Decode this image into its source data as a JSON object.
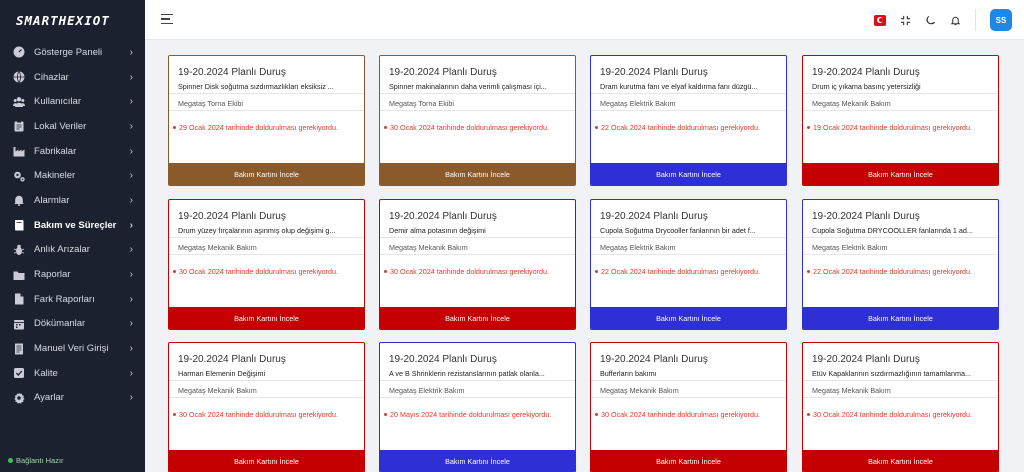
{
  "app": {
    "logo_text": "SMARTHEXIOT",
    "status_text": "Bağlantı Hazır"
  },
  "sidebar": {
    "items": [
      {
        "label": "Gösterge Paneli",
        "icon": "gauge-icon"
      },
      {
        "label": "Cihazlar",
        "icon": "globe-icon"
      },
      {
        "label": "Kullanıcılar",
        "icon": "users-icon"
      },
      {
        "label": "Lokal Veriler",
        "icon": "clipboard-icon"
      },
      {
        "label": "Fabrikalar",
        "icon": "factory-icon"
      },
      {
        "label": "Makineler",
        "icon": "gears-icon"
      },
      {
        "label": "Alarmlar",
        "icon": "bell-icon"
      },
      {
        "label": "Bakım ve Süreçler",
        "icon": "book-icon",
        "active": true
      },
      {
        "label": "Anlık Arızalar",
        "icon": "bug-icon"
      },
      {
        "label": "Raporlar",
        "icon": "folder-icon"
      },
      {
        "label": "Fark Raporları",
        "icon": "file-icon"
      },
      {
        "label": "Dökümanlar",
        "icon": "calendar-icon"
      },
      {
        "label": "Manuel Veri Girişi",
        "icon": "document-icon"
      },
      {
        "label": "Kalite",
        "icon": "check-square-icon"
      },
      {
        "label": "Ayarlar",
        "icon": "gear-icon"
      }
    ]
  },
  "topbar": {
    "menu_icon": "hamburger-icon",
    "language_flag": "turkey-flag-icon",
    "fullscreen_icon": "compress-icon",
    "theme_icon": "moon-icon",
    "notification_icon": "bell-icon",
    "avatar_initials": "SS"
  },
  "colors": {
    "brown": "#8b5a2b",
    "blue": "#2f2fd6",
    "red": "#c40000",
    "due_text": "#e03a2f",
    "avatar": "#1e88e5"
  },
  "cards": [
    {
      "title": "19-20.2024 Planlı Duruş",
      "description": "Spinner Disk soğutma sızdırmazlıkları eksiksiz ...",
      "team": "Megataş Torna Ekibi",
      "due": "29 Ocak 2024 tarihinde doldurulması gerekiyordu.",
      "button": "Bakım Kartını İncele",
      "color": "brown"
    },
    {
      "title": "19-20.2024 Planlı Duruş",
      "description": "Spinner makinalarının daha verimli çalışması içi...",
      "team": "Megataş Torna Ekibi",
      "due": "30 Ocak 2024 tarihinde doldurulması gerekiyordu.",
      "button": "Bakım Kartını İncele",
      "color": "brown"
    },
    {
      "title": "19-20.2024 Planlı Duruş",
      "description": "Dram kurutma fanı ve elyaf kaldırma fanı düzgü...",
      "team": "Megataş Elektrik Bakım",
      "due": "22 Ocak 2024 tarihinde doldurulması gerekiyordu.",
      "button": "Bakım Kartını İncele",
      "color": "blue"
    },
    {
      "title": "19-20.2024 Planlı Duruş",
      "description": "Drum iç yıkama basınç yetersizliği",
      "team": "Megataş Mekanik Bakım",
      "due": "19 Ocak 2024 tarihinde doldurulması gerekiyordu.",
      "button": "Bakım Kartını İncele",
      "color": "red"
    },
    {
      "title": "19-20.2024 Planlı Duruş",
      "description": "Drum yüzey fırçalarının aşınmış olup değişimi g...",
      "team": "Megataş Mekanik Bakım",
      "due": "30 Ocak 2024 tarihinde doldurulması gerekiyordu.",
      "button": "Bakım Kartını İncele",
      "color": "red"
    },
    {
      "title": "19-20.2024 Planlı Duruş",
      "description": "Demir alma potasının değişimi",
      "team": "Megataş Mekanik Bakım",
      "due": "30 Ocak 2024 tarihinde doldurulması gerekiyordu.",
      "button": "Bakım Kartını İncele",
      "color": "red"
    },
    {
      "title": "19-20.2024 Planlı Duruş",
      "description": "Cupola Soğutma Drycooller fanlarının bir adet f...",
      "team": "Megataş Elektrik Bakım",
      "due": "22 Ocak 2024 tarihinde doldurulması gerekiyordu.",
      "button": "Bakım Kartını İncele",
      "color": "blue"
    },
    {
      "title": "19-20.2024 Planlı Duruş",
      "description": "Cupola Soğutma DRYCOOLLER fanlarında 1 ad...",
      "team": "Megataş Elektrik Bakım",
      "due": "22 Ocak 2024 tarihinde doldurulması gerekiyordu.",
      "button": "Bakım Kartını İncele",
      "color": "blue"
    },
    {
      "title": "19-20.2024 Planlı Duruş",
      "description": "Harman Elemenin Değişimi",
      "team": "Megataş Mekanik Bakım",
      "due": "30 Ocak 2024 tarihinde doldurulması gerekiyordu.",
      "button": "Bakım Kartını İncele",
      "color": "red"
    },
    {
      "title": "19-20.2024 Planlı Duruş",
      "description": "A ve B Shrinklerin rezistanslarının patlak olanla...",
      "team": "Megataş Elektrik Bakım",
      "due": "20 Mayıs 2024 tarihinde doldurulması gerekiyordu.",
      "button": "Bakım Kartını İncele",
      "color": "blue"
    },
    {
      "title": "19-20.2024 Planlı Duruş",
      "description": "Bufferların bakımı",
      "team": "Megataş Mekanik Bakım",
      "due": "30 Ocak 2024 tarihinde doldurulması gerekiyordu.",
      "button": "Bakım Kartını İncele",
      "color": "red"
    },
    {
      "title": "19-20.2024 Planlı Duruş",
      "description": "Etüv Kapaklarının sızdırmazlığının tamamlanma...",
      "team": "Megataş Mekanik Bakım",
      "due": "30 Ocak 2024 tarihinde doldurulması gerekiyordu.",
      "button": "Bakım Kartını İncele",
      "color": "red"
    }
  ]
}
